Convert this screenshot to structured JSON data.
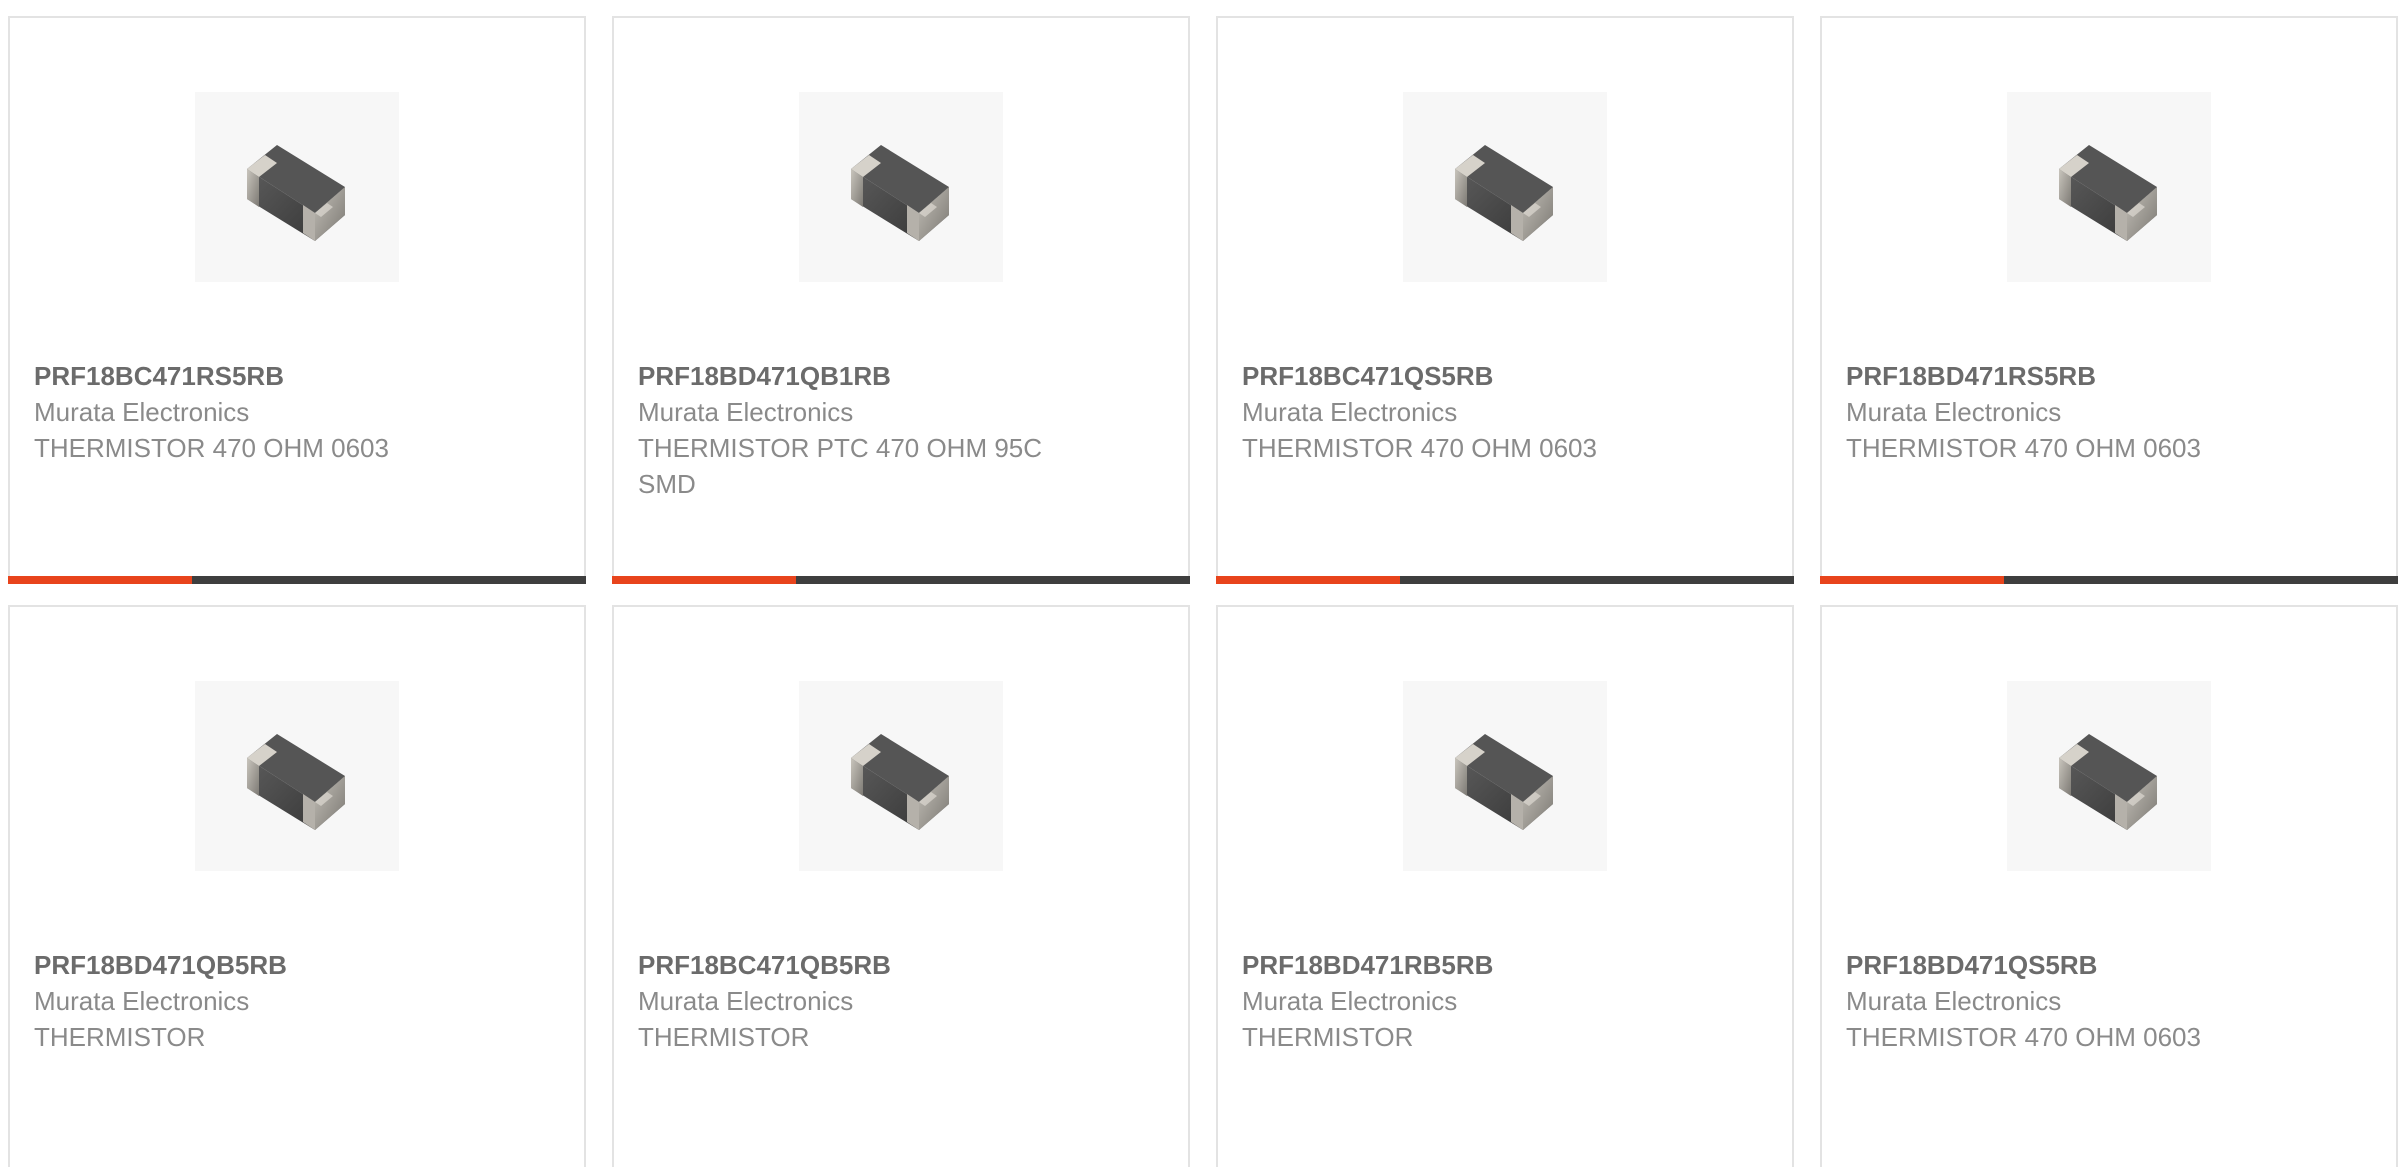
{
  "products": [
    {
      "part_number": "PRF18BC471RS5RB",
      "manufacturer": "Murata Electronics",
      "description": "THERMISTOR 470 OHM 0603"
    },
    {
      "part_number": "PRF18BD471QB1RB",
      "manufacturer": "Murata Electronics",
      "description": "THERMISTOR PTC 470 OHM 95C SMD"
    },
    {
      "part_number": "PRF18BC471QS5RB",
      "manufacturer": "Murata Electronics",
      "description": "THERMISTOR 470 OHM 0603"
    },
    {
      "part_number": "PRF18BD471RS5RB",
      "manufacturer": "Murata Electronics",
      "description": "THERMISTOR 470 OHM 0603"
    },
    {
      "part_number": "PRF18BD471QB5RB",
      "manufacturer": "Murata Electronics",
      "description": "THERMISTOR"
    },
    {
      "part_number": "PRF18BC471QB5RB",
      "manufacturer": "Murata Electronics",
      "description": "THERMISTOR"
    },
    {
      "part_number": "PRF18BD471RB5RB",
      "manufacturer": "Murata Electronics",
      "description": "THERMISTOR"
    },
    {
      "part_number": "PRF18BD471QS5RB",
      "manufacturer": "Murata Electronics",
      "description": "THERMISTOR 470 OHM 0603"
    }
  ],
  "colors": {
    "accent": "#e8441c",
    "bar": "#3e3e3e",
    "border": "#e3e3e3",
    "title_text": "#6b6b6b",
    "body_text": "#8a8a8a"
  },
  "icons": {
    "product_image": "smd-chip-thermistor-icon"
  }
}
